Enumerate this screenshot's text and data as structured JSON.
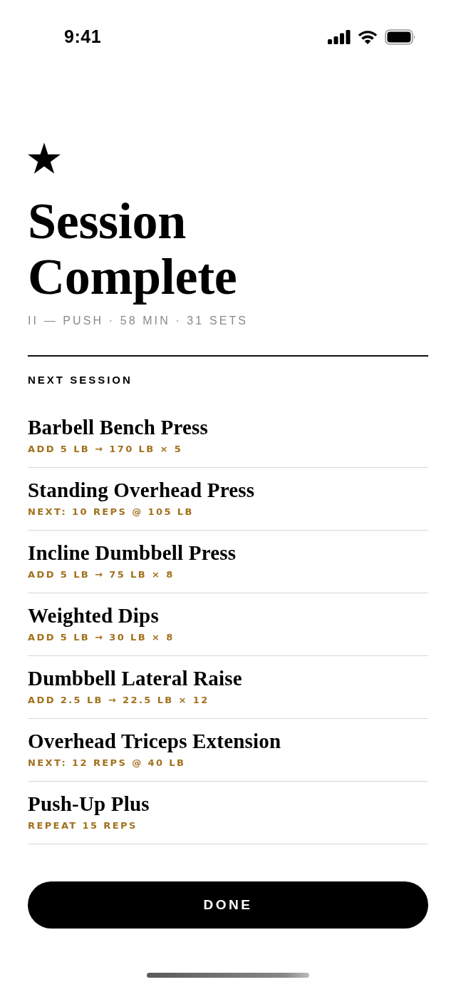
{
  "status_bar": {
    "time": "9:41"
  },
  "header": {
    "title": "Session Complete",
    "summary": "II — PUSH · 58 MIN · 31 SETS"
  },
  "next_session": {
    "heading": "NEXT SESSION",
    "exercises": [
      {
        "name": "Barbell Bench Press",
        "target": "ADD 5 LB → 170 LB × 5"
      },
      {
        "name": "Standing Overhead Press",
        "target": "NEXT: 10 REPS @ 105 LB"
      },
      {
        "name": "Incline Dumbbell Press",
        "target": "ADD 5 LB → 75 LB × 8"
      },
      {
        "name": "Weighted Dips",
        "target": "ADD 5 LB → 30 LB × 8"
      },
      {
        "name": "Dumbbell Lateral Raise",
        "target": "ADD 2.5 LB → 22.5 LB × 12"
      },
      {
        "name": "Overhead Triceps Extension",
        "target": "NEXT: 12 REPS @ 40 LB"
      },
      {
        "name": "Push-Up Plus",
        "target": "REPEAT 15 REPS"
      }
    ]
  },
  "done_button": {
    "label": "DONE"
  }
}
